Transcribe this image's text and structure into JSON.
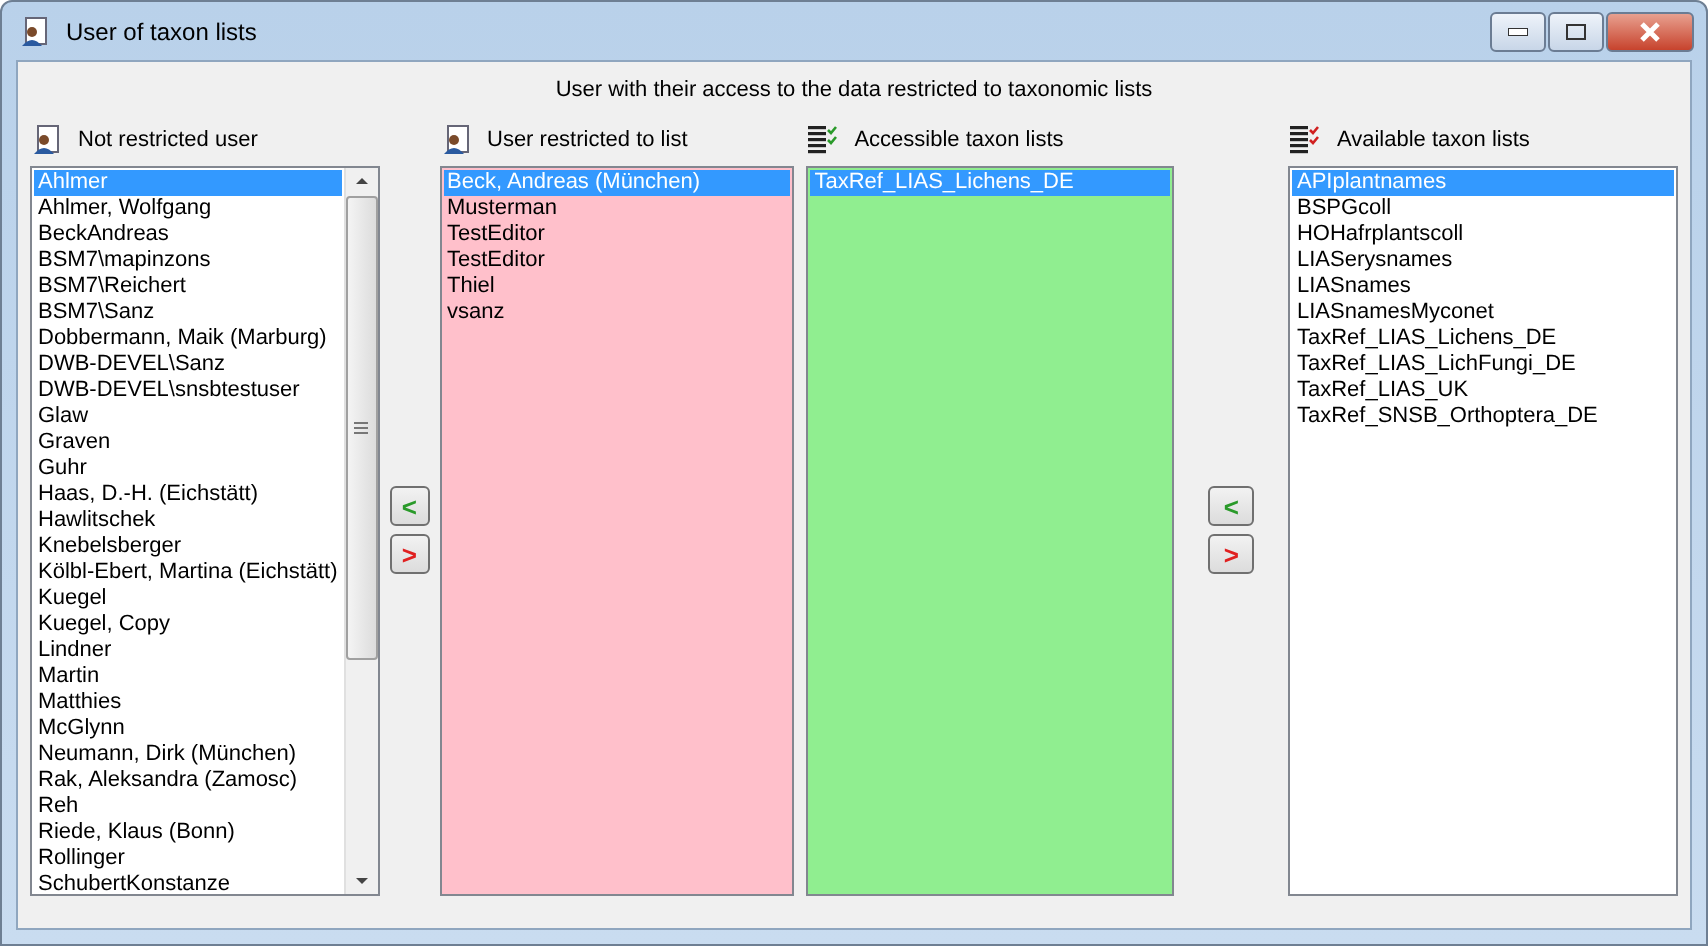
{
  "window": {
    "title": "User of taxon lists"
  },
  "subtitle": "User with their access to the data restricted to taxonomic lists",
  "panels": [
    {
      "label": "Not restricted user",
      "kind": "user",
      "color": "#ffffff",
      "items": [
        {
          "text": "Ahlmer",
          "selected": true
        },
        {
          "text": "Ahlmer, Wolfgang",
          "selected": false
        },
        {
          "text": "BeckAndreas",
          "selected": false
        },
        {
          "text": "BSM7\\mapinzons",
          "selected": false
        },
        {
          "text": "BSM7\\Reichert",
          "selected": false
        },
        {
          "text": "BSM7\\Sanz",
          "selected": false
        },
        {
          "text": "Dobbermann, Maik (Marburg)",
          "selected": false
        },
        {
          "text": "DWB-DEVEL\\Sanz",
          "selected": false
        },
        {
          "text": "DWB-DEVEL\\snsbtestuser",
          "selected": false
        },
        {
          "text": "Glaw",
          "selected": false
        },
        {
          "text": "Graven",
          "selected": false
        },
        {
          "text": "Guhr",
          "selected": false
        },
        {
          "text": "Haas, D.-H. (Eichstätt)",
          "selected": false
        },
        {
          "text": "Hawlitschek",
          "selected": false
        },
        {
          "text": "Knebelsberger",
          "selected": false
        },
        {
          "text": "Kölbl-Ebert, Martina (Eichstätt)",
          "selected": false
        },
        {
          "text": "Kuegel",
          "selected": false
        },
        {
          "text": "Kuegel, Copy",
          "selected": false
        },
        {
          "text": "Lindner",
          "selected": false
        },
        {
          "text": "Martin",
          "selected": false
        },
        {
          "text": "Matthies",
          "selected": false
        },
        {
          "text": "McGlynn",
          "selected": false
        },
        {
          "text": "Neumann, Dirk (München)",
          "selected": false
        },
        {
          "text": "Rak, Aleksandra (Zamosc)",
          "selected": false
        },
        {
          "text": "Reh",
          "selected": false
        },
        {
          "text": "Riede, Klaus (Bonn)",
          "selected": false
        },
        {
          "text": "Rollinger",
          "selected": false
        },
        {
          "text": "SchubertKonstanze",
          "selected": false
        }
      ]
    },
    {
      "label": "User restricted to list",
      "kind": "user",
      "color": "#ffc0cb",
      "items": [
        {
          "text": "Beck, Andreas (München)",
          "selected": true
        },
        {
          "text": "Musterman",
          "selected": false
        },
        {
          "text": "TestEditor",
          "selected": false
        },
        {
          "text": "TestEditor",
          "selected": false
        },
        {
          "text": "Thiel",
          "selected": false
        },
        {
          "text": "vsanz",
          "selected": false
        }
      ]
    },
    {
      "label": "Accessible taxon lists",
      "kind": "accessible",
      "color": "#90ee90",
      "items": [
        {
          "text": "TaxRef_LIAS_Lichens_DE",
          "selected": true
        }
      ]
    },
    {
      "label": "Available taxon lists",
      "kind": "available",
      "color": "#ffffff",
      "items": [
        {
          "text": "APIplantnames",
          "selected": true
        },
        {
          "text": "BSPGcoll",
          "selected": false
        },
        {
          "text": "HOHafrplantscoll",
          "selected": false
        },
        {
          "text": "LIASerysnames",
          "selected": false
        },
        {
          "text": "LIASnames",
          "selected": false
        },
        {
          "text": "LIASnamesMyconet",
          "selected": false
        },
        {
          "text": "TaxRef_LIAS_Lichens_DE",
          "selected": false
        },
        {
          "text": "TaxRef_LIAS_LichFungi_DE",
          "selected": false
        },
        {
          "text": "TaxRef_LIAS_UK",
          "selected": false
        },
        {
          "text": "TaxRef_SNSB_Orthoptera_DE",
          "selected": false
        }
      ]
    }
  ],
  "move_buttons": [
    [
      {
        "label": "<",
        "kind": "add"
      },
      {
        "label": ">",
        "kind": "remove"
      }
    ],
    [
      {
        "label": "<",
        "kind": "add"
      },
      {
        "label": ">",
        "kind": "remove"
      }
    ]
  ]
}
